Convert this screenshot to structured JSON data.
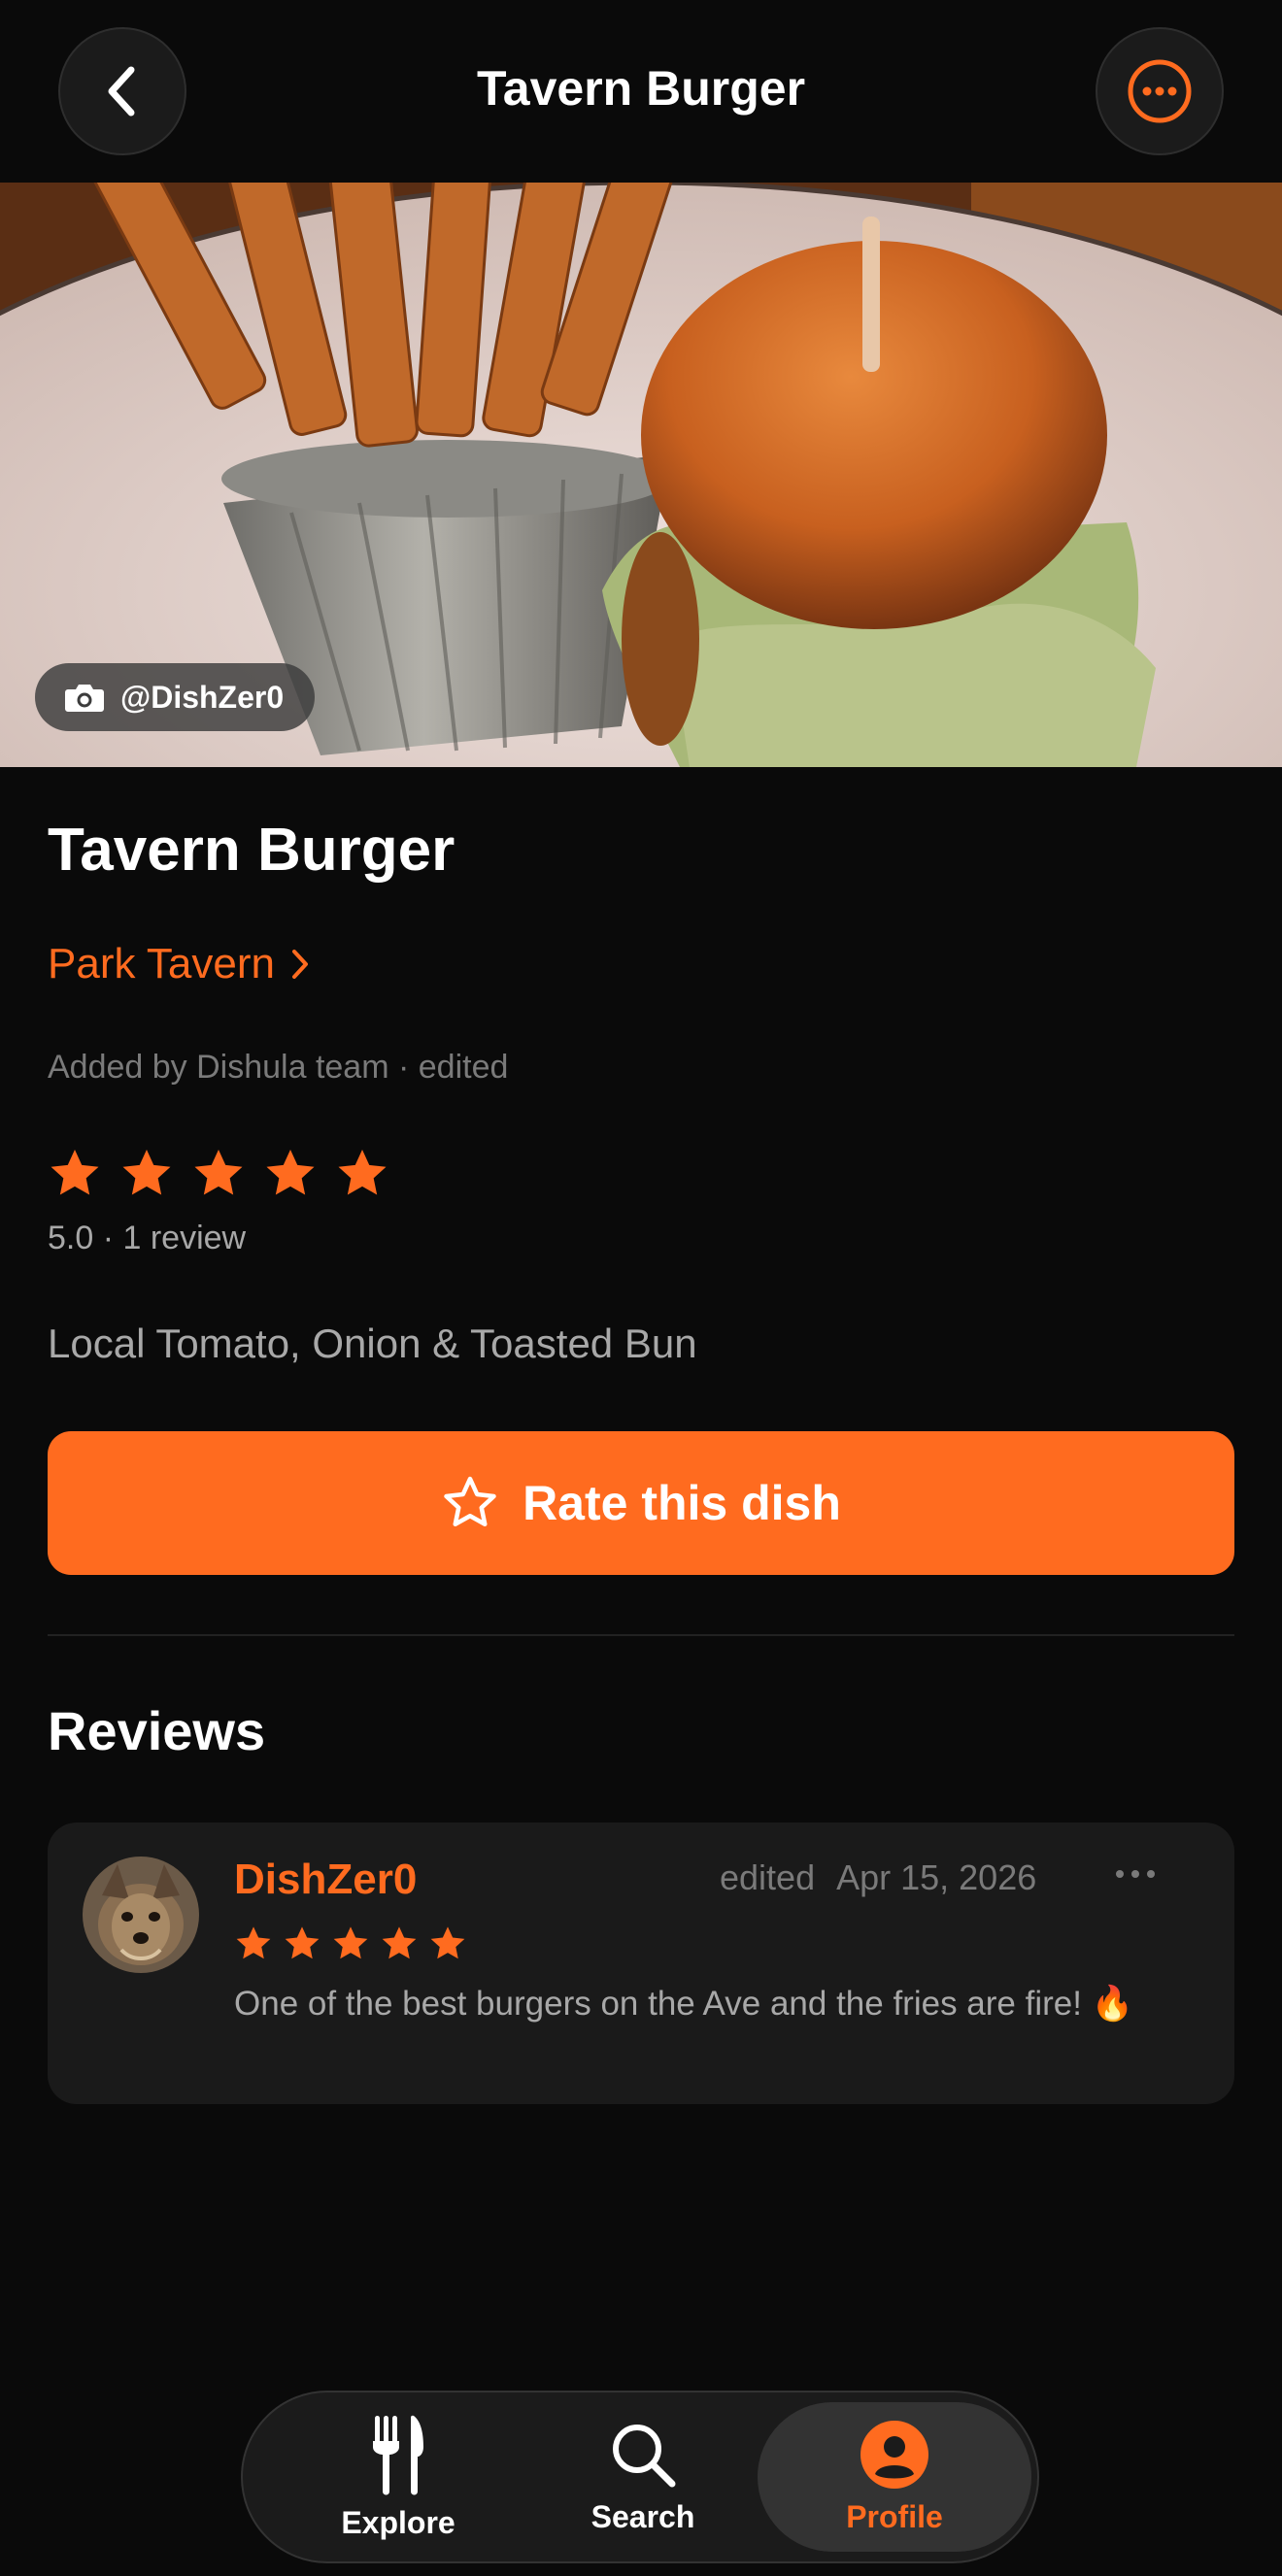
{
  "header": {
    "title": "Tavern Burger",
    "back_icon": "chevron-left-icon",
    "more_icon": "ellipsis-circle-icon"
  },
  "hero": {
    "photo_credit": "@DishZer0",
    "credit_icon": "camera-icon"
  },
  "dish": {
    "title": "Tavern Burger",
    "restaurant": "Park Tavern",
    "added_by": "Added by Dishula team · edited",
    "rating_stars": 5,
    "rating_summary": "5.0 · 1 review",
    "description": "Local Tomato, Onion & Toasted Bun"
  },
  "rate_button": {
    "label": "Rate this dish",
    "icon": "star-outline-icon"
  },
  "reviews": {
    "heading": "Reviews",
    "items": [
      {
        "author": "DishZer0",
        "edited": "edited",
        "date": "Apr 15, 2026",
        "stars": 5,
        "text": "One of the best burgers on the Ave and the fries are fire! 🔥"
      }
    ]
  },
  "tabbar": {
    "explore": "Explore",
    "search": "Search",
    "profile": "Profile",
    "active": "profile"
  },
  "colors": {
    "accent": "#ff6b1f",
    "background": "#0a0a0a",
    "card": "#1a1a1a",
    "muted_text": "#7a7a7a",
    "secondary_text": "#a8a8a8"
  }
}
